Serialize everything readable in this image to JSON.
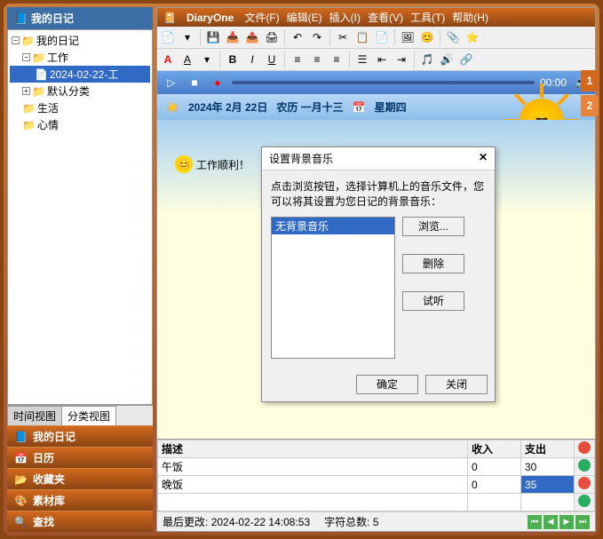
{
  "left": {
    "header": "我的日记",
    "tree": {
      "root": "我的日记",
      "work": "工作",
      "entry": "2024-02-22-工",
      "default_cat": "默认分类",
      "life": "生活",
      "mood": "心情"
    },
    "tabs": {
      "time": "时间视图",
      "category": "分类视图"
    },
    "nav": {
      "diary": "我的日记",
      "calendar": "日历",
      "favorites": "收藏夹",
      "materials": "素材库",
      "search": "查找"
    }
  },
  "app": {
    "title": "DiaryOne",
    "menus": {
      "file": "文件(F)",
      "edit": "编辑(E)",
      "insert": "插入(I)",
      "view": "查看(V)",
      "tools": "工具(T)",
      "help": "帮助(H)"
    }
  },
  "audio": {
    "time": "00:00"
  },
  "date": {
    "full": "2024年 2月 22日",
    "lunar": "农历 一月十三",
    "weekday": "星期四"
  },
  "diary": {
    "text": "工作顺利！"
  },
  "dialog": {
    "title": "设置背景音乐",
    "instruction": "点击浏览按钮，选择计算机上的音乐文件，您可以将其设置为您日记的背景音乐：",
    "no_music": "无背景音乐",
    "browse": "浏览...",
    "delete": "删除",
    "preview": "试听",
    "ok": "确定",
    "close": "关闭"
  },
  "expense": {
    "headers": {
      "desc": "描述",
      "income": "收入",
      "expense": "支出"
    },
    "rows": [
      {
        "desc": "午饭",
        "income": "0",
        "expense": "30"
      },
      {
        "desc": "晚饭",
        "income": "0",
        "expense": "35"
      }
    ]
  },
  "status": {
    "modified_label": "最后更改:",
    "modified_value": "2024-02-22 14:08:53",
    "chars_label": "字符总数:",
    "chars_value": "5"
  },
  "side_tabs": [
    "1",
    "2"
  ]
}
